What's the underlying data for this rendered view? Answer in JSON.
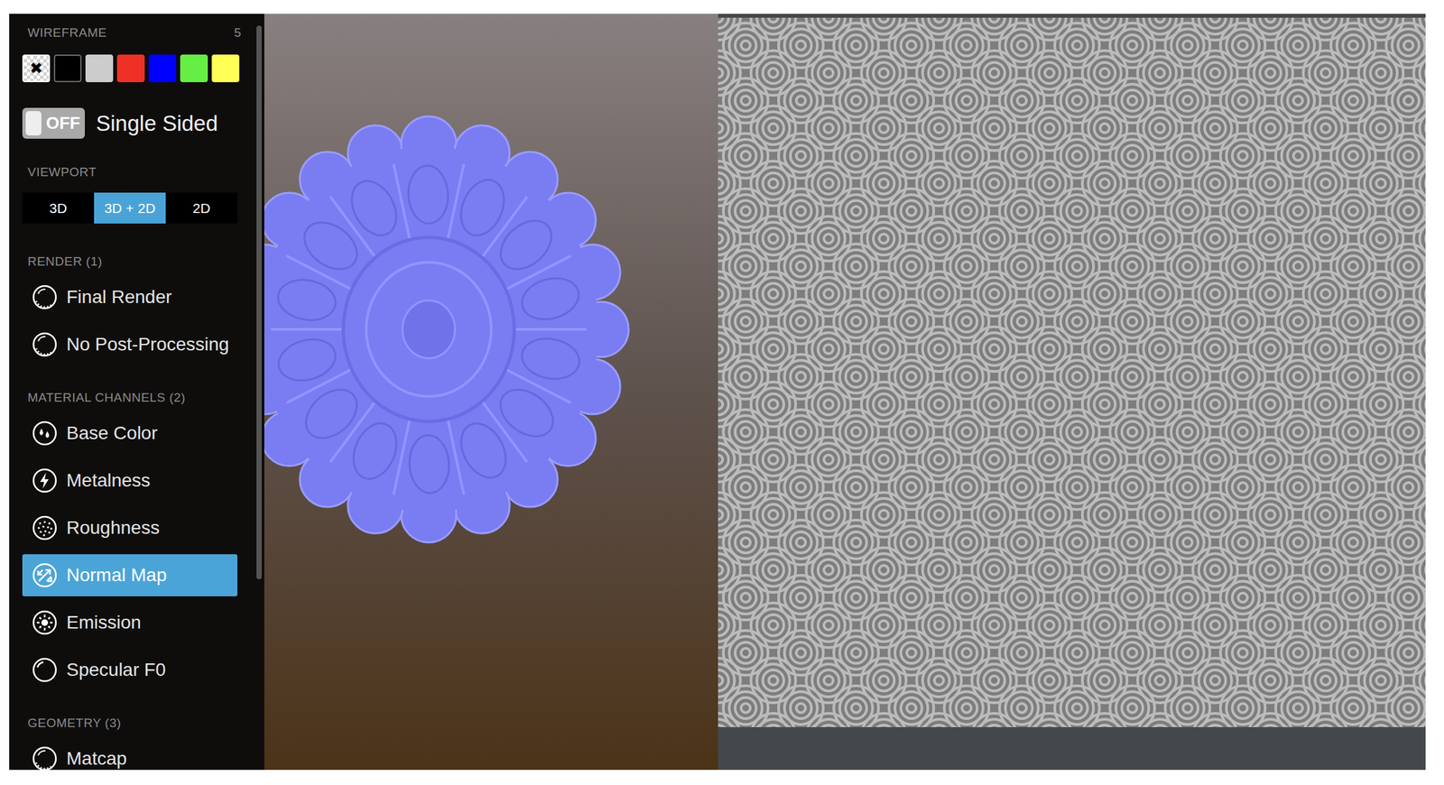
{
  "wireframe": {
    "label": "WIREFRAME",
    "count": "5",
    "swatches": [
      {
        "kind": "none",
        "glyph": "✖",
        "selected": true,
        "color": "#ffffff"
      },
      {
        "kind": "color",
        "selected": false,
        "color": "#000000"
      },
      {
        "kind": "color",
        "selected": false,
        "color": "#cccccc"
      },
      {
        "kind": "color",
        "selected": false,
        "color": "#ee3124"
      },
      {
        "kind": "color",
        "selected": false,
        "color": "#0000ff"
      },
      {
        "kind": "color",
        "selected": false,
        "color": "#66ee44"
      },
      {
        "kind": "color",
        "selected": false,
        "color": "#ffff55"
      }
    ]
  },
  "single_sided": {
    "toggle_label": "OFF",
    "on": false,
    "label": "Single Sided"
  },
  "viewport": {
    "label": "VIEWPORT",
    "options": [
      {
        "label": "3D",
        "selected": false
      },
      {
        "label": "3D + 2D",
        "selected": true
      },
      {
        "label": "2D",
        "selected": false
      }
    ]
  },
  "sections": [
    {
      "title": "RENDER (1)",
      "items": [
        {
          "label": "Final Render",
          "icon": "sphere",
          "selected": false
        },
        {
          "label": "No Post-Processing",
          "icon": "sphere",
          "selected": false
        }
      ]
    },
    {
      "title": "MATERIAL CHANNELS (2)",
      "items": [
        {
          "label": "Base Color",
          "icon": "drops",
          "selected": false
        },
        {
          "label": "Metalness",
          "icon": "bolt",
          "selected": false
        },
        {
          "label": "Roughness",
          "icon": "dots",
          "selected": false
        },
        {
          "label": "Normal Map",
          "icon": "arrows",
          "selected": true
        },
        {
          "label": "Emission",
          "icon": "sun",
          "selected": false
        },
        {
          "label": "Specular F0",
          "icon": "ring",
          "selected": false
        }
      ]
    },
    {
      "title": "GEOMETRY (3)",
      "items": [
        {
          "label": "Matcap",
          "icon": "sphere",
          "selected": false
        }
      ]
    }
  ]
}
